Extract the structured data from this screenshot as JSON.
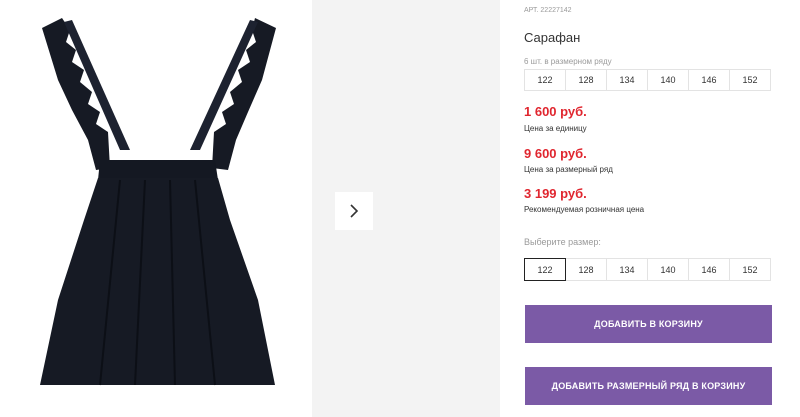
{
  "product": {
    "article": "АРТ. 22227142",
    "title": "Сарафан",
    "pack_label": "6 шт. в размерном ряду",
    "pack_sizes": [
      "122",
      "128",
      "134",
      "140",
      "146",
      "152"
    ]
  },
  "prices": [
    {
      "value": "1 600 руб.",
      "label": "Цена за единицу"
    },
    {
      "value": "9 600 руб.",
      "label": "Цена за размерный ряд"
    },
    {
      "value": "3 199 руб.",
      "label": "Рекомендуемая розничная цена"
    }
  ],
  "size_select": {
    "label": "Выберите размер:",
    "options": [
      "122",
      "128",
      "134",
      "140",
      "146",
      "152"
    ],
    "selected": "122"
  },
  "buttons": {
    "add_to_cart": "ДОБАВИТЬ В КОРЗИНУ",
    "add_pack_to_cart": "ДОБАВИТЬ РАЗМЕРНЫЙ РЯД В КОРЗИНУ"
  },
  "gallery": {
    "next_icon": "chevron-right-icon"
  },
  "colors": {
    "price": "#e0262f",
    "button": "#7b5aa6",
    "dress": "#161a24"
  }
}
